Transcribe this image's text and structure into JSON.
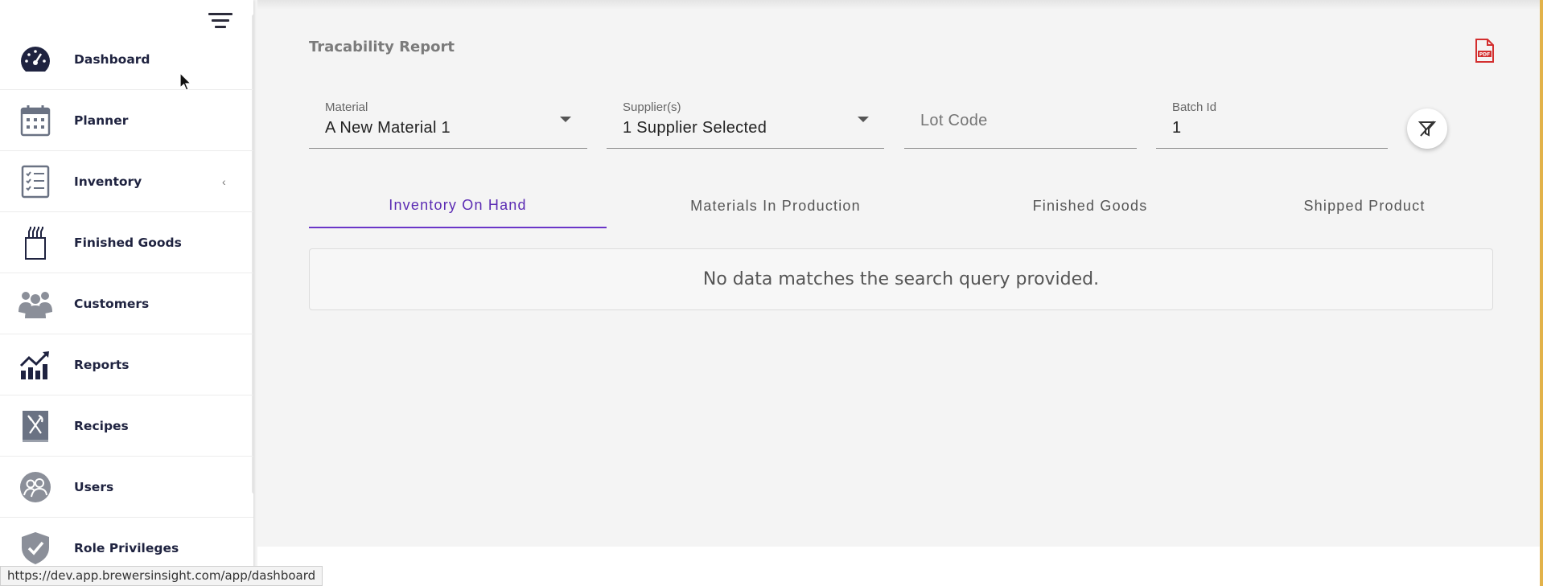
{
  "sidebar": {
    "items": [
      {
        "label": "Dashboard",
        "icon": "dashboard-gauge-icon"
      },
      {
        "label": "Planner",
        "icon": "calendar-icon"
      },
      {
        "label": "Inventory",
        "icon": "checklist-icon",
        "chevron": "‹"
      },
      {
        "label": "Finished Goods",
        "icon": "bottles-icon"
      },
      {
        "label": "Customers",
        "icon": "customers-group-icon"
      },
      {
        "label": "Reports",
        "icon": "trend-chart-icon"
      },
      {
        "label": "Recipes",
        "icon": "recipe-book-icon"
      },
      {
        "label": "Users",
        "icon": "user-circle-icon"
      },
      {
        "label": "Role Privileges",
        "icon": "shield-check-icon"
      }
    ]
  },
  "status_bar": {
    "url": "https://dev.app.brewersinsight.com/app/dashboard"
  },
  "page": {
    "title": "Tracability Report"
  },
  "filters": {
    "material": {
      "label": "Material",
      "value": "A New Material 1"
    },
    "suppliers": {
      "label": "Supplier(s)",
      "value": "1 Supplier Selected"
    },
    "lot_code": {
      "placeholder": "Lot Code"
    },
    "batch_id": {
      "label": "Batch Id",
      "value": "1"
    }
  },
  "tabs": [
    {
      "label": "Inventory On Hand",
      "active": true
    },
    {
      "label": "Materials In Production",
      "active": false
    },
    {
      "label": "Finished Goods",
      "active": false
    },
    {
      "label": "Shipped Product",
      "active": false
    }
  ],
  "results": {
    "empty_message": "No data matches the search query provided."
  },
  "colors": {
    "accent": "#6a35c8",
    "nav_text": "#1f2340",
    "pdf_red": "#d32f2f"
  }
}
